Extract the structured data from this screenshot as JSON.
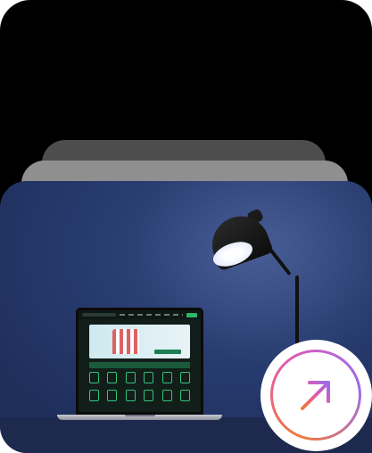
{
  "cards": {
    "back_color": "#000000",
    "stack_dark_color": "#4d4d4d",
    "stack_mid_color": "#8f8f8f"
  },
  "photo": {
    "wall_color": "#293d72",
    "accent_green": "#2fb36a"
  },
  "action": {
    "icon": "arrow-up-right-icon",
    "gradient": [
      "#f07a3a",
      "#e05ab0",
      "#9a6bf0"
    ]
  }
}
